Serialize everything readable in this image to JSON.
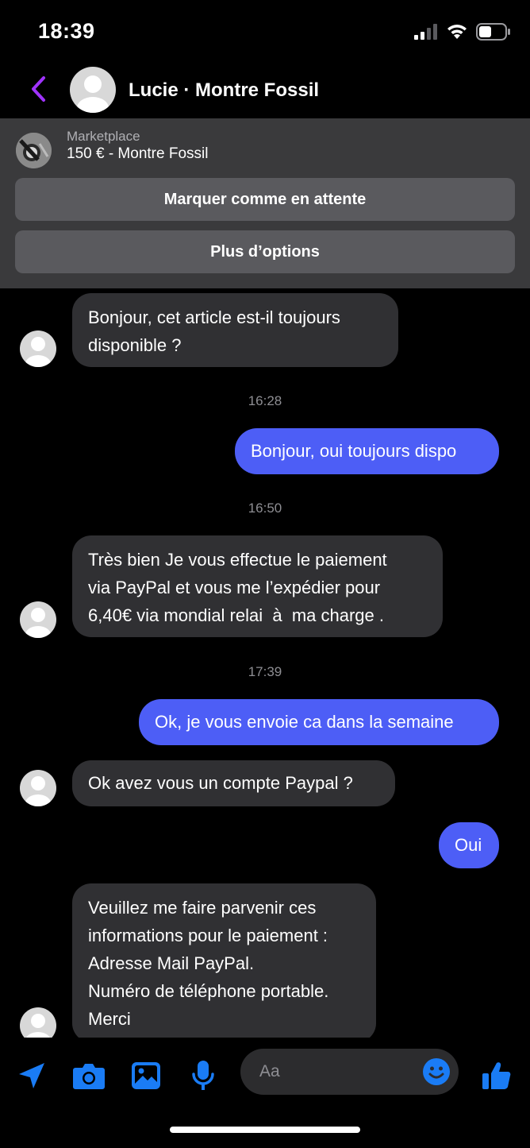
{
  "status_bar": {
    "time": "18:39"
  },
  "header": {
    "title": "Lucie · Montre Fossil"
  },
  "marketplace": {
    "label": "Marketplace",
    "price_title": "150 € - Montre Fossil",
    "mark_pending_label": "Marquer comme en attente",
    "more_options_label": "Plus d’options"
  },
  "messages": [
    {
      "lines": [
        "Bonjour, cet article est-il toujours",
        "disponible ?"
      ]
    },
    {
      "time": "16:28"
    },
    {
      "lines": [
        "Bonjour, oui toujours dispo"
      ]
    },
    {
      "time": "16:50"
    },
    {
      "lines": [
        "Très bien Je vous effectue le paiement",
        "via PayPal et vous me l’expédier pour",
        "6,40€ via mondial relai  à  ma charge ."
      ]
    },
    {
      "time": "17:39"
    },
    {
      "lines": [
        "Ok, je vous envoie ca dans la semaine"
      ]
    },
    {
      "lines": [
        "Ok avez vous un compte Paypal ?"
      ]
    },
    {
      "lines": [
        "Oui"
      ]
    },
    {
      "lines": [
        "Veuillez me faire parvenir ces",
        "informations pour le paiement :",
        "Adresse Mail PayPal.",
        "Numéro de téléphone portable.",
        "Merci"
      ]
    }
  ],
  "composer": {
    "placeholder": "Aa",
    "icons": [
      "send-location-icon",
      "camera-icon",
      "gallery-icon",
      "microphone-icon",
      "emoji-icon",
      "thumbs-up-icon"
    ]
  },
  "colors": {
    "accent": "#4d5ef6",
    "icon_blue": "#1a7cf5",
    "back_purple": "#a033ff",
    "incoming_bubble": "#303033"
  }
}
